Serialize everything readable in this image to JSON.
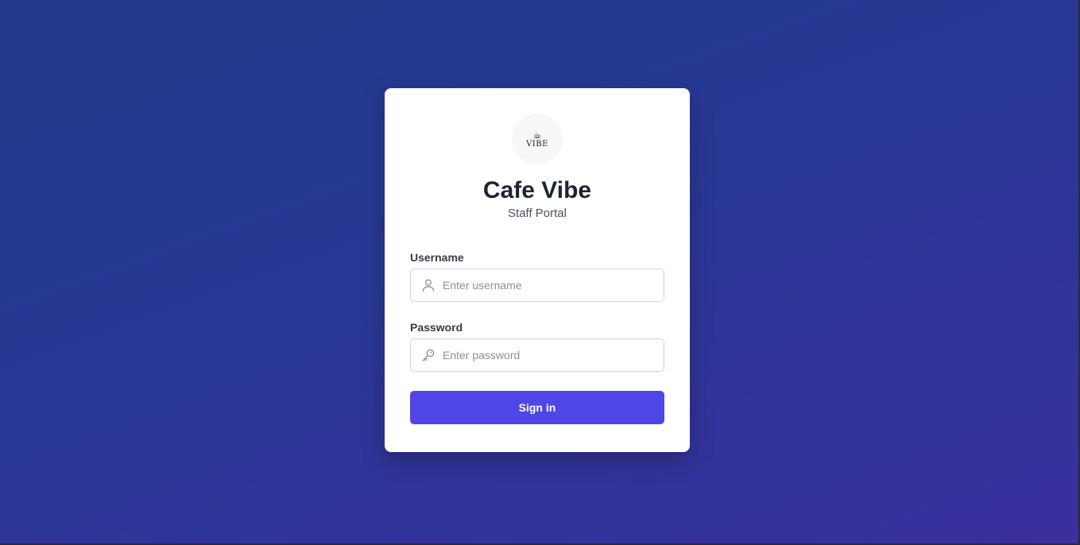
{
  "brand": {
    "logo_text": "VIBE",
    "logo_icon": "coffee-cup-icon",
    "title": "Cafe Vibe",
    "subtitle": "Staff Portal"
  },
  "form": {
    "username": {
      "label": "Username",
      "placeholder": "Enter username",
      "value": "",
      "icon": "user-icon"
    },
    "password": {
      "label": "Password",
      "placeholder": "Enter password",
      "value": "",
      "icon": "key-icon"
    },
    "submit_label": "Sign in"
  },
  "colors": {
    "background_start": "#223a8c",
    "background_end": "#3a309e",
    "accent": "#4f46e5",
    "title": "#1c2433"
  }
}
